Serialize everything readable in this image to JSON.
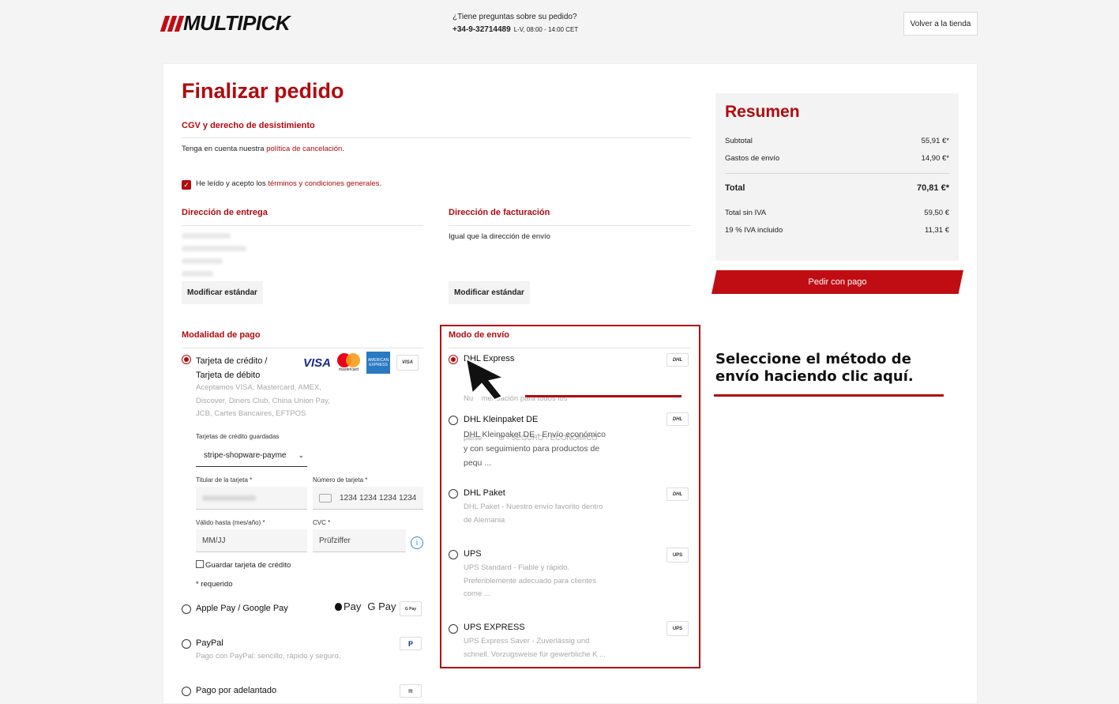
{
  "header": {
    "logo": "MULTIPICK",
    "help_question": "¿Tiene preguntas sobre su pedido?",
    "phone": "+34-9-32714489",
    "hours": "L-V, 08:00 - 14:00 CET",
    "back_button": "Volver a la tienda"
  },
  "checkout": {
    "title": "Finalizar pedido",
    "terms_title": "CGV y derecho de desistimiento",
    "cancel_note_prefix": "Tenga en cuenta nuestra ",
    "cancel_link": "política de cancelación",
    "cancel_note_suffix": ".",
    "accept_prefix": "He leído y acepto los ",
    "accept_link": "términos y condiciones generales",
    "accept_suffix": ".",
    "accept_checked": true
  },
  "addresses": {
    "delivery_title": "Dirección de entrega",
    "billing_title": "Dirección de facturación",
    "billing_text": "Igual que la dirección de envío",
    "modify_label": "Modificar estándar"
  },
  "payment": {
    "title": "Modalidad de pago",
    "card_label_line1": "Tarjeta de crédito /",
    "card_label_line2": "Tarjeta de débito",
    "card_desc": [
      "Aceptamos VISA, Mastercard, AMEX,",
      "Discover, Diners Club, China Union Pay,",
      "JCB, Cartes Bancaires, EFTPOS"
    ],
    "visa_logo": "VISA",
    "mastercard_logo": "mastercard",
    "amex_logo": "AMERICAN EXPRESS",
    "saved_cards_label": "Tarjetas de crédito guardadas",
    "saved_card_value": "stripe-shopware-payme",
    "holder_label": "Titular de la tarjeta *",
    "number_label": "Número de tarjeta *",
    "number_placeholder": "1234 1234 1234 1234",
    "expiry_label": "Válido hasta (mes/año) *",
    "expiry_placeholder": "MM/JJ",
    "cvc_label": "CVC *",
    "cvc_placeholder": "Prüfziffer",
    "save_card_label": "Guardar tarjeta de crédito",
    "required_note": "* requerido",
    "applepay_label": "Apple Pay / Google Pay",
    "applepay_logo": "Pay",
    "googlepay_logo": "G Pay",
    "paypal_label": "PayPal",
    "paypal_desc": "Pago con PayPal: sencillo, rápido y seguro.",
    "prepay_label": "Pago por adelantado"
  },
  "shipping": {
    "title": "Modo de envío",
    "methods": [
      {
        "name": "DHL Express",
        "desc": [
          "Nu    mendación para todos los",
          "paíse        O - SEGURO - ECONÓMICO"
        ],
        "badge": "DHL",
        "selected": true
      },
      {
        "name": "DHL Kleinpaket DE",
        "desc": [
          "DHL Kleinpaket DE - Envío económico",
          "y con seguimiento para productos de",
          "pequ ..."
        ],
        "badge": "DHL",
        "selected": false
      },
      {
        "name": "DHL Paket",
        "desc": [
          "DHL Paket - Nuestro envío favorito dentro",
          "de Alemania"
        ],
        "badge": "DHL",
        "selected": false
      },
      {
        "name": "UPS",
        "desc": [
          "UPS Standard - Fiable y rápido.",
          "Preferiblemente adecuado para clientes",
          "come ..."
        ],
        "badge": "UPS",
        "selected": false
      },
      {
        "name": "UPS EXPRESS",
        "desc": [
          "UPS Express Saver - Zuverlässig und",
          "schnell. Vorzugsweise für gewerbliche K ..."
        ],
        "badge": "UPS",
        "selected": false
      }
    ]
  },
  "summary": {
    "title": "Resumen",
    "subtotal_label": "Subtotal",
    "subtotal": "55,91 €*",
    "shipping_label": "Gastos de envío",
    "shipping": "14,90 €*",
    "total_label": "Total",
    "total": "70,81 €*",
    "net_label": "Total sin IVA",
    "net": "59,50 €",
    "vat_label": "19 % IVA incluido",
    "vat": "11,31 €",
    "order_button": "Pedir con pago"
  },
  "callout": {
    "line1": "Seleccione el método de",
    "line2": "envío haciendo clic aquí."
  },
  "colors": {
    "brand_red": "#b10a0f",
    "button_red": "#c00d14"
  }
}
